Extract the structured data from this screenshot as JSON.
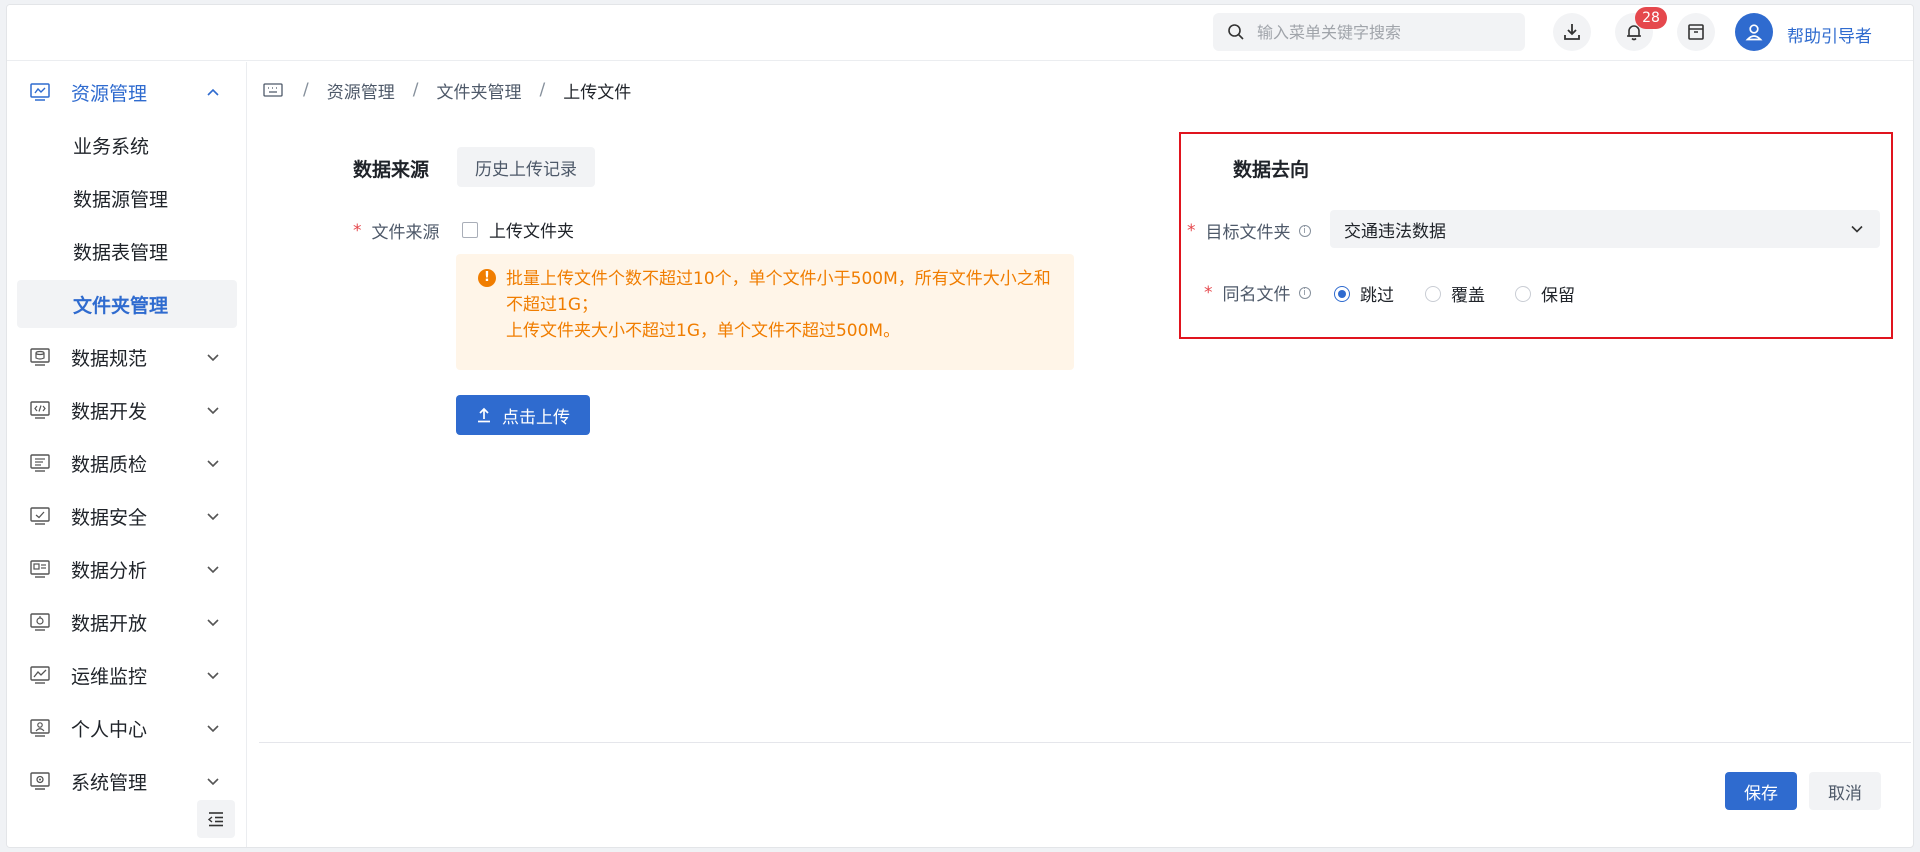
{
  "header": {
    "search_placeholder": "输入菜单关键字搜索",
    "notification_count": "28",
    "username": "帮助引导者"
  },
  "sidebar": {
    "items": [
      {
        "label": "资源管理",
        "icon": "monitor-icon",
        "expanded": true
      },
      {
        "label": "数据规范",
        "icon": "database-icon"
      },
      {
        "label": "数据开发",
        "icon": "code-icon"
      },
      {
        "label": "数据质检",
        "icon": "checklist-icon"
      },
      {
        "label": "数据安全",
        "icon": "shield-check-icon"
      },
      {
        "label": "数据分析",
        "icon": "analysis-icon"
      },
      {
        "label": "数据开放",
        "icon": "share-icon"
      },
      {
        "label": "运维监控",
        "icon": "trend-icon"
      },
      {
        "label": "个人中心",
        "icon": "user-card-icon"
      },
      {
        "label": "系统管理",
        "icon": "settings-icon"
      }
    ],
    "sub_items": [
      {
        "label": "业务系统"
      },
      {
        "label": "数据源管理"
      },
      {
        "label": "数据表管理"
      },
      {
        "label": "文件夹管理",
        "active": true
      }
    ]
  },
  "breadcrumb": {
    "items": [
      "资源管理",
      "文件夹管理",
      "上传文件"
    ]
  },
  "source": {
    "title": "数据来源",
    "history_button": "历史上传记录",
    "file_source_label": "文件来源",
    "checkbox_label": "上传文件夹",
    "alert_line1": "批量上传文件个数不超过10个，单个文件小于500M，所有文件大小之和",
    "alert_line2": "不超过1G；",
    "alert_line3": "上传文件夹大小不超过1G，单个文件不超过500M。",
    "upload_button": "点击上传"
  },
  "destination": {
    "title": "数据去向",
    "target_folder_label": "目标文件夹",
    "target_folder_value": "交通违法数据",
    "same_name_label": "同名文件",
    "options": [
      "跳过",
      "覆盖",
      "保留"
    ],
    "selected": "跳过"
  },
  "footer": {
    "save": "保存",
    "cancel": "取消"
  },
  "colors": {
    "primary": "#2f6bcf",
    "warning_text": "#f07d00",
    "warning_bg": "#fff5e8",
    "highlight_border": "#e0141e",
    "badge": "#e5484d"
  }
}
